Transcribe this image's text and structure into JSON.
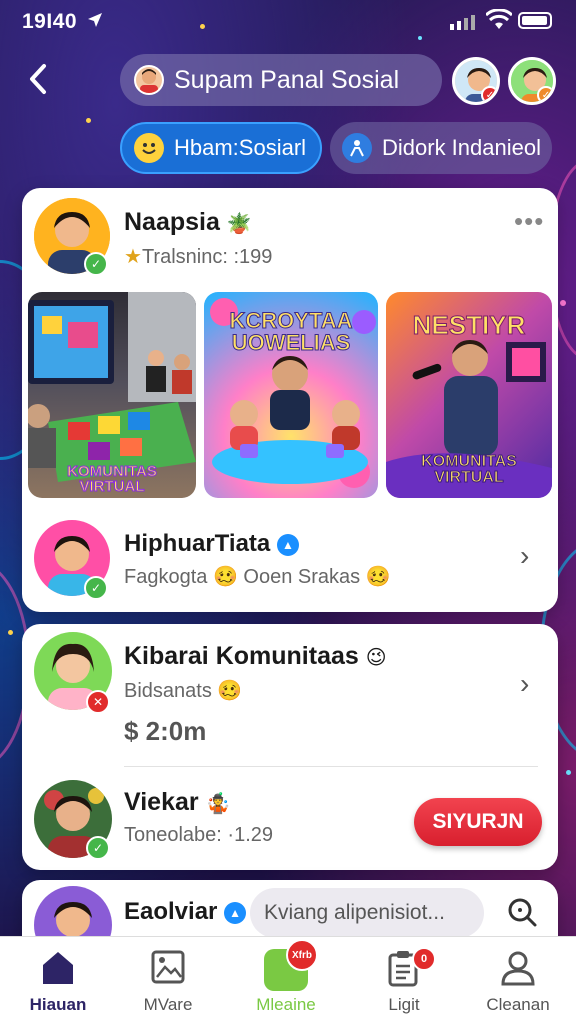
{
  "status_bar": {
    "time": "19I40",
    "location_icon": "location-arrow-icon"
  },
  "header": {
    "back_icon": "chevron-left-icon",
    "title": "Supam Panal Sosial",
    "avatar_badges": [
      "red",
      "orange"
    ]
  },
  "tabs": [
    {
      "label": "Hbam:Sosiarl",
      "icon": "smiley-face-icon",
      "active": true
    },
    {
      "label": "Didork Indanieol",
      "icon": "person-icon",
      "active": false
    }
  ],
  "featured_post": {
    "name": "Naapsia",
    "name_emoji": "🪴",
    "subtitle": "Tralsninc: :199",
    "subtitle_prefix": "★",
    "more_icon": "more-dots-icon",
    "thumbnails": [
      {
        "label": "KOMUNITAS\nVIRTUAL",
        "colors": [
          "#3d3b45",
          "#6b8bb5"
        ]
      },
      {
        "label": "KCROYTAA\nUOWELIAS",
        "colors": [
          "#ff5fb0",
          "#1fb4ff"
        ]
      },
      {
        "label": "NESTIYR",
        "bottom_label": "KOMUNITAS\nVIRTUAL",
        "colors": [
          "#ff7a2c",
          "#7b35c9"
        ]
      }
    ]
  },
  "list_items": [
    {
      "name": "HiphuarTiata",
      "verified": true,
      "subtitle": "Fagkogta 🥴 Ooen Srakas 🥴",
      "badge_color": "#45b64a"
    },
    {
      "name": "Kibarai Komunitaas",
      "emoji": "😉",
      "subtitle": "Bidsanats 🥴",
      "price": "$ 2:0m",
      "badge_color": "#e12b2b"
    },
    {
      "name": "Viekar",
      "emoji": "🤹",
      "subtitle": "Toneolabe: ·1.29",
      "button": "SIYURJN",
      "badge_color": "#45b64a"
    }
  ],
  "partial_item": {
    "name": "Eaolviar",
    "verified": true,
    "search_placeholder": "Kviang alipenisiot...",
    "search_icon": "search-icon"
  },
  "nav": [
    {
      "label": "Hiauan",
      "icon": "home-icon",
      "active": true
    },
    {
      "label": "MVare",
      "icon": "image-gallery-icon"
    },
    {
      "label": "Mleaine",
      "icon": "green-square-icon",
      "badge": "Xfrb",
      "highlight": true
    },
    {
      "label": "Ligit",
      "icon": "clipboard-icon",
      "badge": "0"
    },
    {
      "label": "Cleanan",
      "icon": "user-profile-icon"
    }
  ],
  "colors": {
    "accent_blue": "#1a6fd6",
    "red_button": "#e12b2b",
    "nav_active": "#2d2466",
    "nav_highlight": "#7ac943"
  }
}
